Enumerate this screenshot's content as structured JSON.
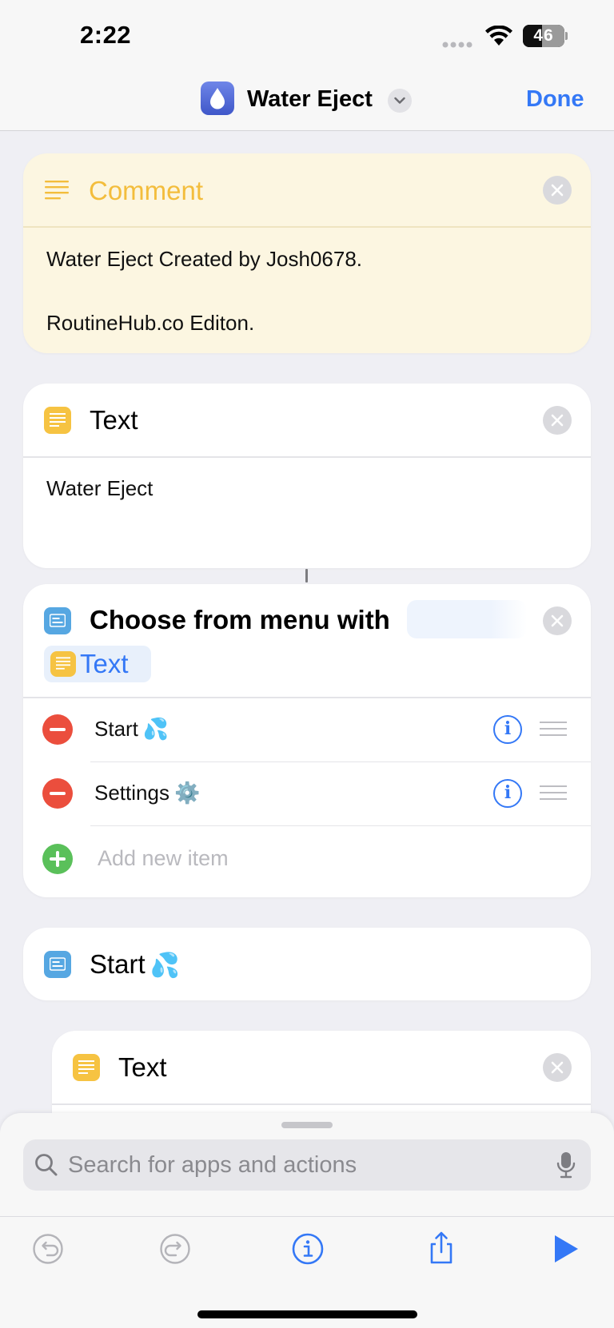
{
  "status_bar": {
    "time": "2:22",
    "battery_text": "46",
    "battery_level": 0.46
  },
  "nav": {
    "title": "Water Eject",
    "done_label": "Done",
    "accent_color": "#3478f6",
    "app_icon": "water-drop-icon"
  },
  "comment": {
    "title": "Comment",
    "body": "Water Eject Created by Josh0678.\n\nRoutineHub.co Editon.",
    "accent_color": "#f3bd3c"
  },
  "text_action": {
    "title": "Text",
    "value": "Water Eject"
  },
  "choose_menu": {
    "title": "Choose from menu with",
    "variable": "Text",
    "items": [
      {
        "label": "Start",
        "emoji": "💦"
      },
      {
        "label": "Settings",
        "emoji": "⚙️"
      }
    ],
    "add_item_placeholder": "Add new item"
  },
  "start_section": {
    "label": "Start",
    "emoji": "💦"
  },
  "text_action_2": {
    "title": "Text"
  },
  "search": {
    "placeholder": "Search for apps and actions"
  },
  "toolbar": {
    "icons": [
      "undo-icon",
      "redo-icon",
      "info-icon",
      "share-icon",
      "play-icon"
    ]
  }
}
